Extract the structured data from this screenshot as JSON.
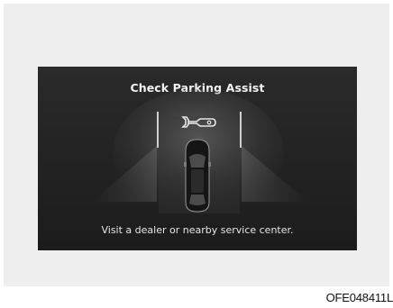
{
  "screen": {
    "title": "Check Parking Assist",
    "message": "Visit a dealer or nearby service center.",
    "icons": [
      "wrench-icon",
      "car-top-view-icon"
    ]
  },
  "figure_code": "OFE048411L"
}
